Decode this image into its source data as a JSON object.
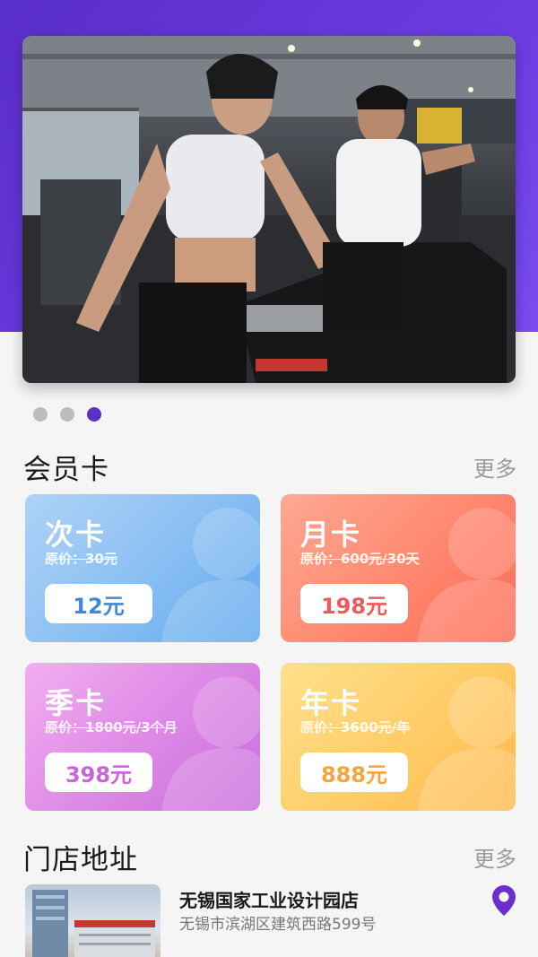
{
  "banner": {
    "image": "gym-treadmill-photo",
    "dots": 3,
    "active_dot": 3
  },
  "membership": {
    "title": "会员卡",
    "more": "更多",
    "cards": [
      {
        "name": "次卡",
        "original": "原价：30元",
        "price": "12元"
      },
      {
        "name": "月卡",
        "original": "原价：600元/30天",
        "price": "198元"
      },
      {
        "name": "季卡",
        "original": "原价：1800元/3个月",
        "price": "398元"
      },
      {
        "name": "年卡",
        "original": "原价：3600元/年",
        "price": "888元"
      }
    ]
  },
  "stores": {
    "title": "门店地址",
    "more": "更多",
    "items": [
      {
        "name": "无锡国家工业设计园店",
        "address": "无锡市滨湖区建筑西路599号",
        "icon": "location-pin-icon"
      }
    ]
  },
  "colors": {
    "header": "#5a2ec9",
    "active_dot": "#5b2fc8",
    "pin": "#6b2fd0"
  }
}
